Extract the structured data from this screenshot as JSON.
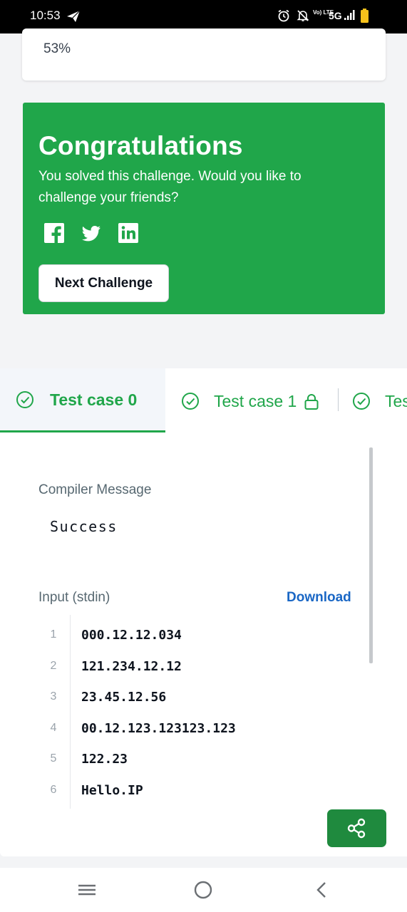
{
  "status_bar": {
    "time": "10:53",
    "network": "5G",
    "volte": "Vo) LTE",
    "icons": [
      "telegram-send-icon",
      "alarm-icon",
      "notifications-off-icon",
      "signal-icon",
      "battery-icon"
    ]
  },
  "progress_card": {
    "percent_text": "53%"
  },
  "congrats": {
    "title": "Congratulations",
    "message": "You solved this challenge. Would you like to challenge your friends?",
    "share_icons": [
      "facebook-icon",
      "twitter-icon",
      "linkedin-icon"
    ],
    "next_button": "Next Challenge",
    "bg_color": "#20a64a"
  },
  "test_cases": {
    "tabs": [
      {
        "label": "Test case 0",
        "status": "passed",
        "active": true,
        "locked": false
      },
      {
        "label": "Test case 1",
        "status": "passed",
        "active": false,
        "locked": true
      },
      {
        "label": "Tes",
        "status": "passed",
        "active": false,
        "locked": false
      }
    ]
  },
  "result": {
    "compiler_label": "Compiler Message",
    "compiler_message": "Success",
    "input_label": "Input (stdin)",
    "download_label": "Download",
    "input_lines": [
      {
        "num": "1",
        "text": "000.12.12.034"
      },
      {
        "num": "2",
        "text": "121.234.12.12"
      },
      {
        "num": "3",
        "text": "23.45.12.56"
      },
      {
        "num": "4",
        "text": "00.12.123.123123.123"
      },
      {
        "num": "5",
        "text": "122.23"
      },
      {
        "num": "6",
        "text": "Hello.IP"
      }
    ]
  },
  "share_button": {
    "icon": "share-icon"
  },
  "nav_bar": {
    "icons": [
      "recent-apps-icon",
      "home-icon",
      "back-icon"
    ]
  }
}
